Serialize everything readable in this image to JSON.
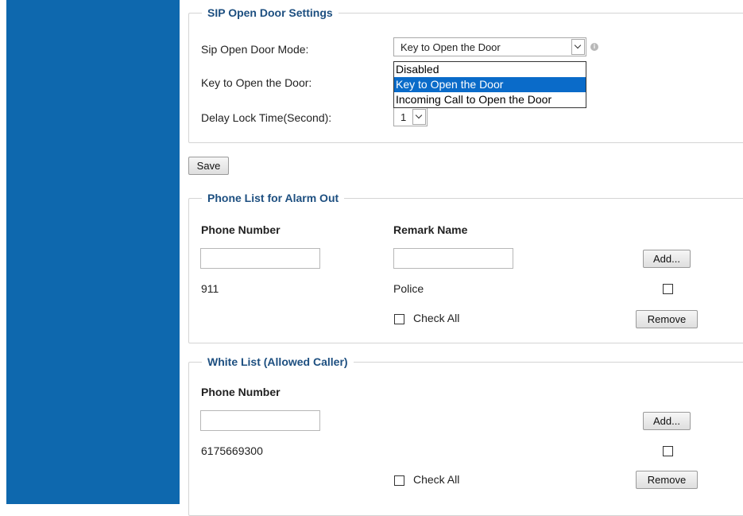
{
  "sip_section": {
    "legend": "SIP Open Door Settings",
    "mode_label": "Sip Open Door Mode:",
    "mode_value": "Key to Open the Door",
    "mode_options": [
      "Disabled",
      "Key to Open the Door",
      "Incoming Call to Open the Door"
    ],
    "key_label": "Key to Open the Door:",
    "delay_label": "Delay Lock Time(Second):",
    "delay_value": "1"
  },
  "save_label": "Save",
  "alarm_section": {
    "legend": "Phone List for Alarm Out",
    "col_phone": "Phone Number",
    "col_remark": "Remark Name",
    "add_label": "Add...",
    "rows": [
      {
        "phone": "911",
        "remark": "Police",
        "checked": false
      }
    ],
    "check_all_label": "Check All",
    "remove_label": "Remove"
  },
  "white_section": {
    "legend": "White List (Allowed Caller)",
    "col_phone": "Phone Number",
    "add_label": "Add...",
    "rows": [
      {
        "phone": "6175669300",
        "checked": false
      }
    ],
    "check_all_label": "Check All",
    "remove_label": "Remove"
  },
  "colors": {
    "sidebar": "#0e68ae",
    "legend_text": "#1d4f80",
    "selected_option": "#0a6bc9"
  }
}
